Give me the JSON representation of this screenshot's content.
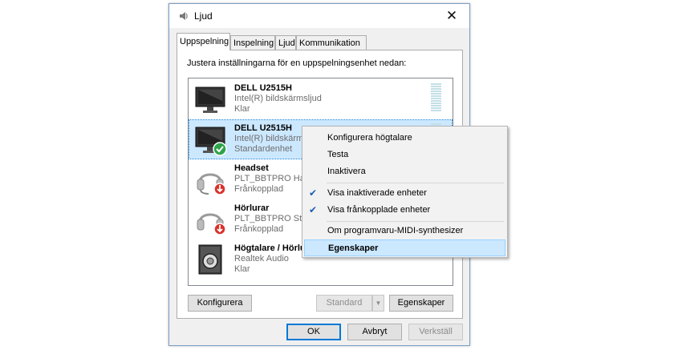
{
  "window": {
    "title": "Ljud",
    "close_glyph": "✕"
  },
  "tabs": [
    {
      "label": "Uppspelning",
      "active": true
    },
    {
      "label": "Inspelning"
    },
    {
      "label": "Ljud"
    },
    {
      "label": "Kommunikation"
    }
  ],
  "instruction": "Justera inställningarna för en uppspelningsenhet nedan:",
  "devices": [
    {
      "name": "DELL U2515H",
      "sub": "Intel(R) bildskärmsljud",
      "status": "Klar",
      "icon": "monitor-icon"
    },
    {
      "name": "DELL U2515H",
      "sub": "Intel(R) bildskärm",
      "status": "Standardenhet",
      "icon": "monitor-icon",
      "badge": "default-check-icon",
      "selected": true
    },
    {
      "name": "Headset",
      "sub": "PLT_BBTPRO Hand",
      "status": "Frånkopplad",
      "icon": "headset-icon",
      "badge": "disconnected-arrow-icon"
    },
    {
      "name": "Hörlurar",
      "sub": "PLT_BBTPRO Stere",
      "status": "Frånkopplad",
      "icon": "headphones-icon",
      "badge": "disconnected-arrow-icon"
    },
    {
      "name": "Högtalare / Hörlu",
      "sub": "Realtek Audio",
      "status": "Klar",
      "icon": "speaker-icon"
    }
  ],
  "buttons": {
    "configure": "Konfigurera",
    "set_default": "Standard",
    "properties": "Egenskaper",
    "ok": "OK",
    "cancel": "Avbryt",
    "apply": "Verkställ"
  },
  "context_menu": {
    "items": [
      {
        "label": "Konfigurera högtalare"
      },
      {
        "label": "Testa"
      },
      {
        "label": "Inaktivera"
      },
      {
        "label": "Visa inaktiverade enheter",
        "checked": true
      },
      {
        "label": "Visa frånkopplade enheter",
        "checked": true
      },
      {
        "label": "Om programvaru-MIDI-synthesizer"
      },
      {
        "label": "Egenskaper",
        "highlighted": true
      }
    ]
  },
  "colors": {
    "accent": "#0078d7",
    "selection": "#cce8ff",
    "check": "#1c5eb3"
  }
}
